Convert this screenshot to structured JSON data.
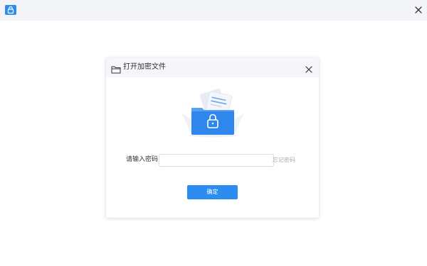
{
  "window": {
    "app_icon": "lock-folder-icon",
    "close_icon": "close-icon"
  },
  "dialog": {
    "title": "打开加密文件",
    "title_icon": "folder-outline-icon",
    "close_icon": "close-icon",
    "illustration": "encrypted-folder-illustration",
    "password_label": "请输入密码",
    "password_value": "",
    "password_placeholder": "",
    "forgot_password_link": "忘记密码",
    "confirm_button": "确定"
  },
  "colors": {
    "accent": "#2d8cf0",
    "titlebar_bg": "#f3f4f8",
    "dialog_header_bg": "#f5f6f9",
    "link_gray": "#a8abb2"
  }
}
